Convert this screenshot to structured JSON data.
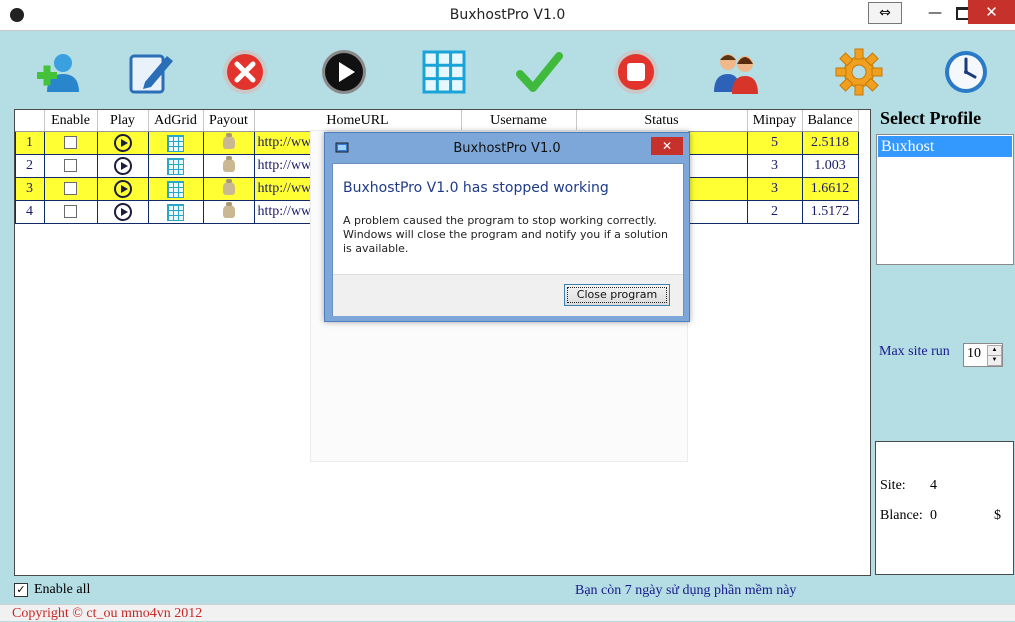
{
  "window": {
    "title": "BuxhostPro V1.0"
  },
  "toolbar": {
    "icons": [
      "add-user-icon",
      "edit-icon",
      "delete-icon",
      "play-icon",
      "grid-icon",
      "check-icon",
      "stop-icon",
      "users-icon",
      "settings-gear-icon",
      "clock-icon"
    ]
  },
  "grid": {
    "columns": [
      "Enable",
      "Play",
      "AdGrid",
      "Payout",
      "HomeURL",
      "Username",
      "Status",
      "Minpay",
      "Balance"
    ],
    "rows": [
      {
        "num": "1",
        "url": "http://www",
        "minpay": "5",
        "balance": "2.5118",
        "highlight": true
      },
      {
        "num": "2",
        "url": "http://www",
        "minpay": "3",
        "balance": "1.003",
        "highlight": false
      },
      {
        "num": "3",
        "url": "http://www",
        "minpay": "3",
        "balance": "1.6612",
        "highlight": true
      },
      {
        "num": "4",
        "url": "http://www",
        "minpay": "2",
        "balance": "1.5172",
        "highlight": false
      }
    ]
  },
  "dialog": {
    "title": "BuxhostPro V1.0",
    "heading": "BuxhostPro V1.0 has stopped working",
    "message": "A problem caused the program to stop working correctly. Windows will close the program and notify you if a solution is available.",
    "button": "Close program",
    "close_glyph": "✕"
  },
  "sidebar": {
    "select_profile": "Select Profile",
    "profiles": [
      "Buxhost"
    ],
    "max_site_label": "Max site run",
    "max_site_value": "10",
    "site_label": "Site:",
    "site_value": "4",
    "balance_label": "Blance:",
    "balance_value": "0",
    "currency": "$"
  },
  "footer": {
    "enable_all": "Enable all",
    "notice": "Bạn còn 7 ngày sử dụng phần mềm này",
    "copyright": "Copyright © ct_ou mmo4vn 2012"
  },
  "colors": {
    "highlight_row": "#ffff33",
    "background": "#b4dde4",
    "close_red": "#c7312b",
    "selection": "#3399ff"
  }
}
